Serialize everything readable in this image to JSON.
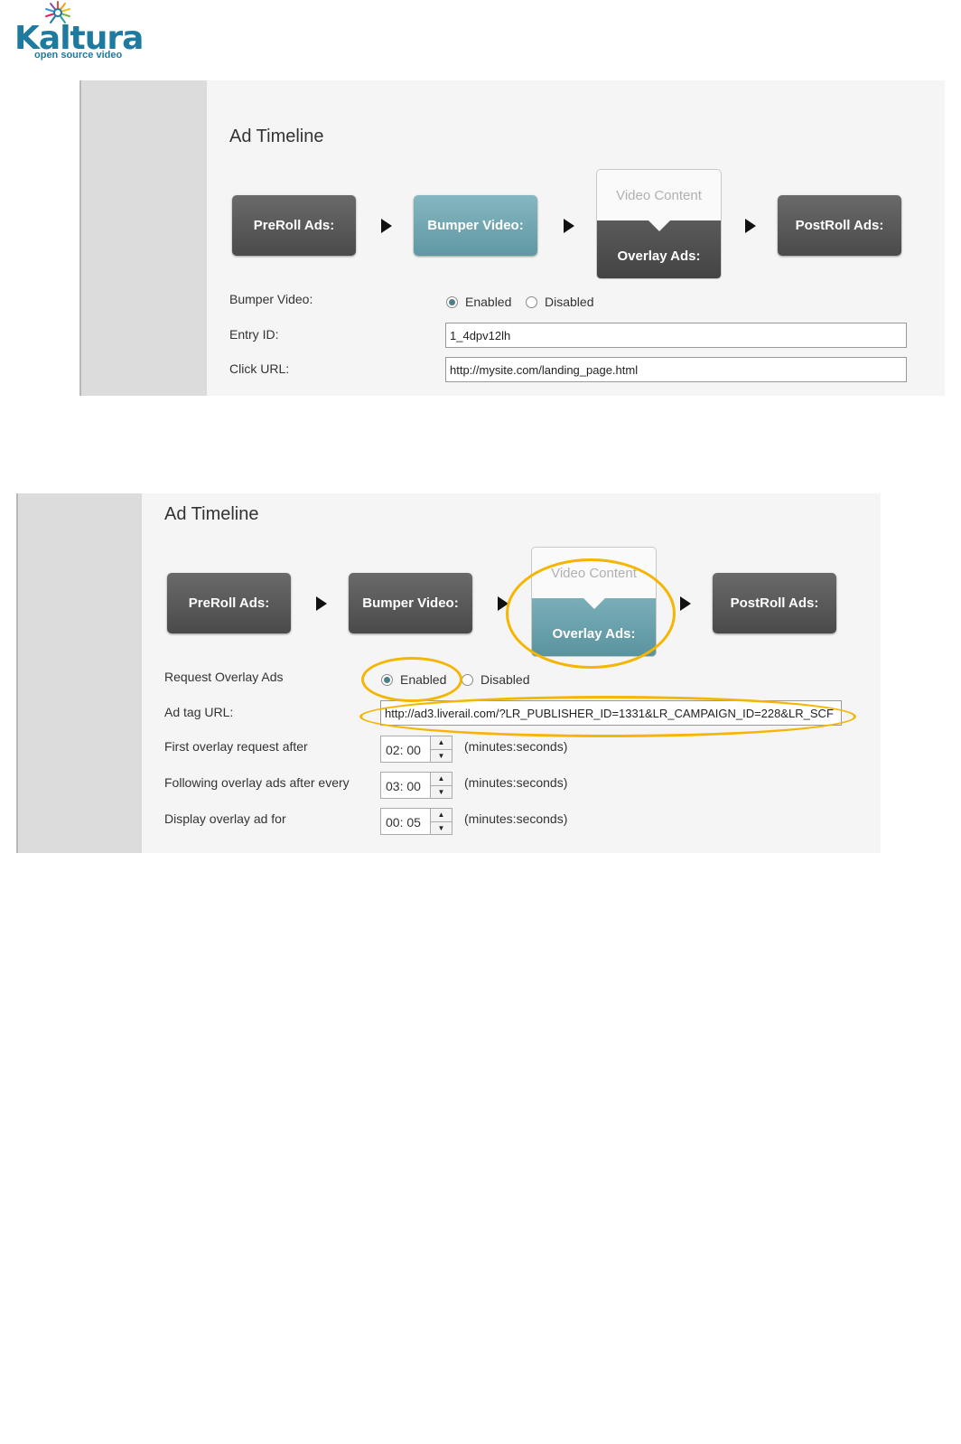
{
  "logo": {
    "brand": "Kaltura",
    "tagline": "open source video"
  },
  "colors": {
    "teal": "#5f98a3",
    "dark_box": "#4a4a4a",
    "highlight": "#f5b500",
    "brand": "#1f7a9f"
  },
  "panel1": {
    "heading": "Ad Timeline",
    "timeline": {
      "preroll": "PreRoll Ads:",
      "bumper": "Bumper Video:",
      "video_content": "Video Content",
      "overlay": "Overlay Ads:",
      "postroll": "PostRoll Ads:"
    },
    "bumper_label": "Bumper Video:",
    "enabled": "Enabled",
    "disabled": "Disabled",
    "entry_label": "Entry ID:",
    "entry_value": "1_4dpv12lh",
    "click_label": "Click URL:",
    "click_value": "http://mysite.com/landing_page.html"
  },
  "panel2": {
    "heading": "Ad Timeline",
    "timeline": {
      "preroll": "PreRoll Ads:",
      "bumper": "Bumper Video:",
      "video_content": "Video Content",
      "overlay": "Overlay Ads:",
      "postroll": "PostRoll Ads:"
    },
    "request_label": "Request Overlay Ads",
    "enabled": "Enabled",
    "disabled": "Disabled",
    "adtag_label": "Ad tag URL:",
    "adtag_value": "http://ad3.liverail.com/?LR_PUBLISHER_ID=1331&LR_CAMPAIGN_ID=228&LR_SCF",
    "first_label": "First overlay request after",
    "first_value": "02: 00",
    "following_label": "Following overlay ads after every",
    "following_value": "03: 00",
    "display_label": "Display overlay ad for",
    "display_value": "00: 05",
    "unit": "(minutes:seconds)"
  }
}
